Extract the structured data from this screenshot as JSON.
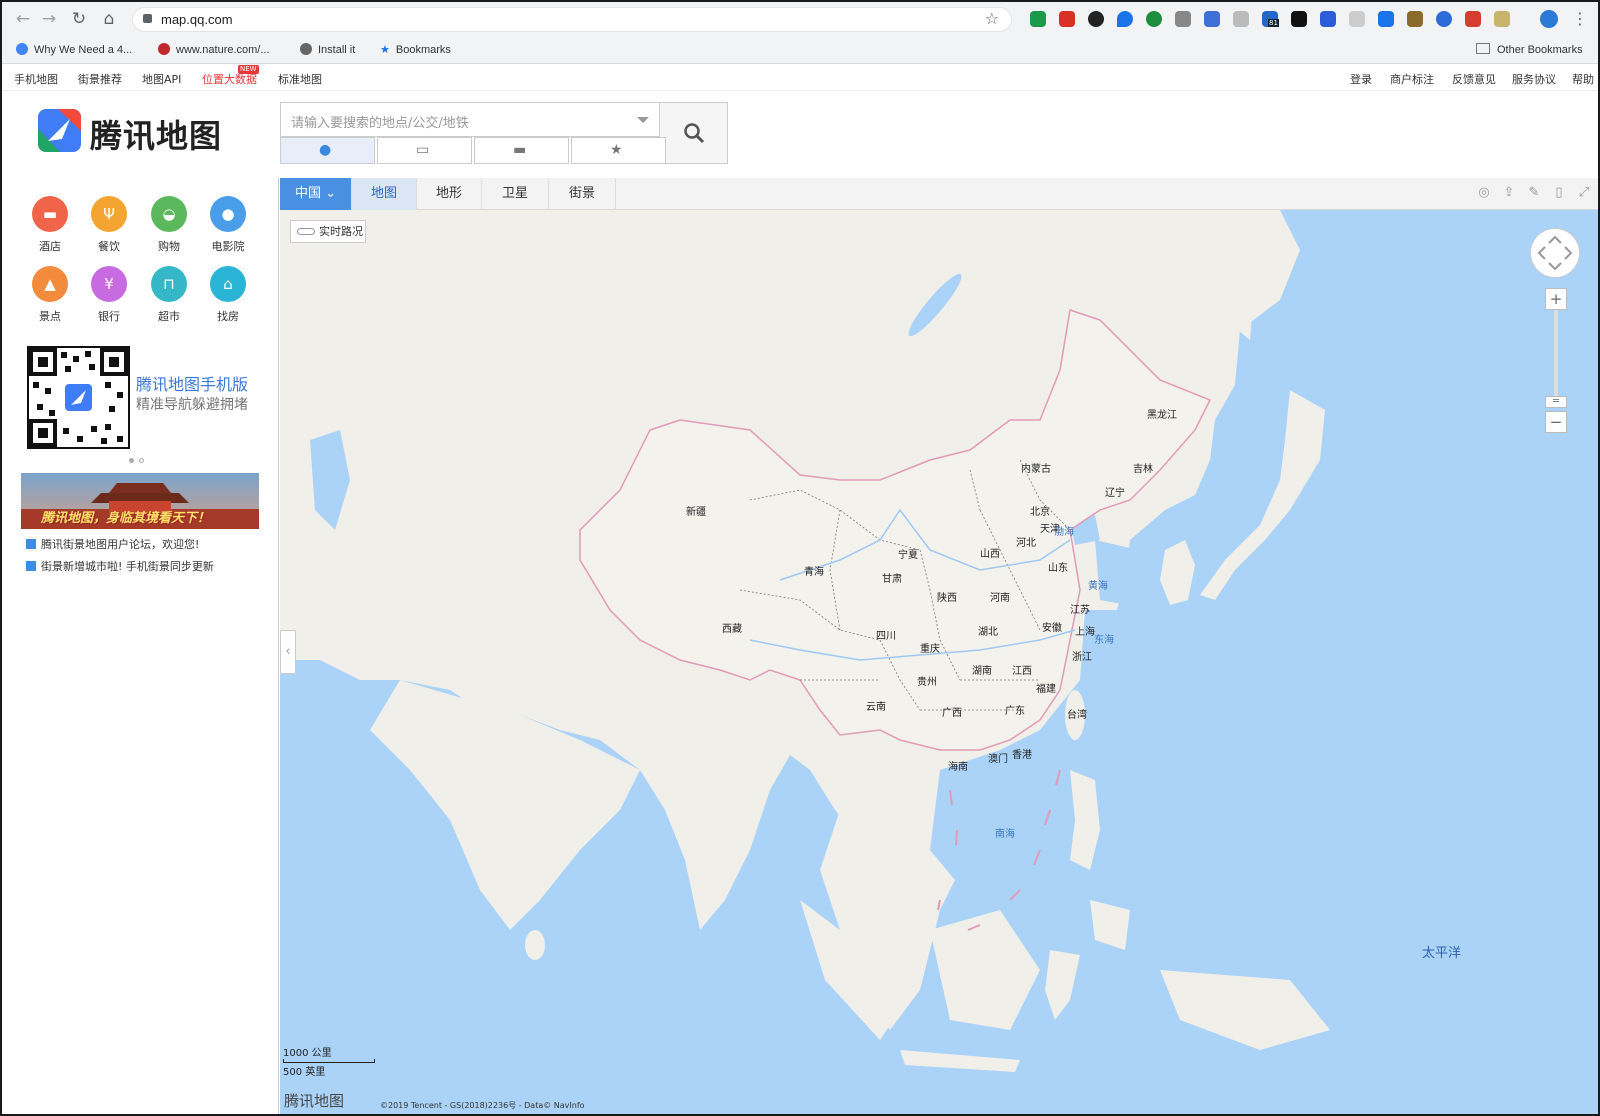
{
  "browser": {
    "url": "map.qq.com",
    "bookmarks": [
      {
        "label": "Why We Need a 4..."
      },
      {
        "label": "www.nature.com/..."
      },
      {
        "label": "Install it"
      },
      {
        "label": "Bookmarks"
      }
    ],
    "other_bookmarks": "Other Bookmarks",
    "extension_badge": "81"
  },
  "site_nav": {
    "left": [
      "手机地图",
      "街景推荐",
      "地图API",
      "位置大数据",
      "标准地图"
    ],
    "new_badge": "NEW",
    "right": [
      "登录",
      "商户标注",
      "反馈意见",
      "服务协议",
      "帮助"
    ]
  },
  "header": {
    "logo_text": "腾讯地图",
    "search_placeholder": "请输入要搜索的地点/公交/地铁"
  },
  "sidebar": {
    "poi": [
      {
        "label": "酒店",
        "color": "#f0654a",
        "glyph": "▬"
      },
      {
        "label": "餐饮",
        "color": "#f4a430",
        "glyph": "Ψ"
      },
      {
        "label": "购物",
        "color": "#5cb85c",
        "glyph": "◒"
      },
      {
        "label": "电影院",
        "color": "#4a9de8",
        "glyph": "●"
      },
      {
        "label": "景点",
        "color": "#f38b3c",
        "glyph": "▲"
      },
      {
        "label": "银行",
        "color": "#c96be0",
        "glyph": "¥"
      },
      {
        "label": "超市",
        "color": "#36b7c7",
        "glyph": "⊓"
      },
      {
        "label": "找房",
        "color": "#2ab4d6",
        "glyph": "⌂"
      }
    ],
    "qr_title": "腾讯地图手机版",
    "qr_subtitle": "精准导航躲避拥堵",
    "banner_caption": "腾讯地图，身临其境看天下！",
    "news": [
      "腾讯街景地图用户论坛，欢迎您!",
      "街景新增城市啦! 手机街景同步更新"
    ]
  },
  "map_tabs": {
    "region": "中国",
    "tabs": [
      "地图",
      "地形",
      "卫星",
      "街景"
    ],
    "selected": "地图"
  },
  "map": {
    "traffic_button": "实时路况",
    "zoom_in": "+",
    "zoom_out": "−",
    "scale_km": "1000 公里",
    "scale_mi": "500 英里",
    "logo": "腾讯地图",
    "copyright": "©2019 Tencent - GS(2018)2236号 - Data© NavInfo",
    "provinces": [
      "新疆",
      "西藏",
      "青海",
      "甘肃",
      "宁夏",
      "内蒙古",
      "黑龙江",
      "吉林",
      "辽宁",
      "北京",
      "天津",
      "河北",
      "山西",
      "山东",
      "陕西",
      "河南",
      "江苏",
      "安徽",
      "上海",
      "湖北",
      "四川",
      "重庆",
      "浙江",
      "湖南",
      "江西",
      "贵州",
      "福建",
      "云南",
      "广西",
      "广东",
      "台湾",
      "澳门",
      "香港",
      "海南"
    ],
    "seas": [
      "渤海",
      "黄海",
      "东海",
      "南海",
      "太平洋"
    ]
  },
  "colors": {
    "land": "#f0efea",
    "water": "#aad3f7",
    "border": "#e39ab8",
    "accent": "#4a90e2"
  }
}
